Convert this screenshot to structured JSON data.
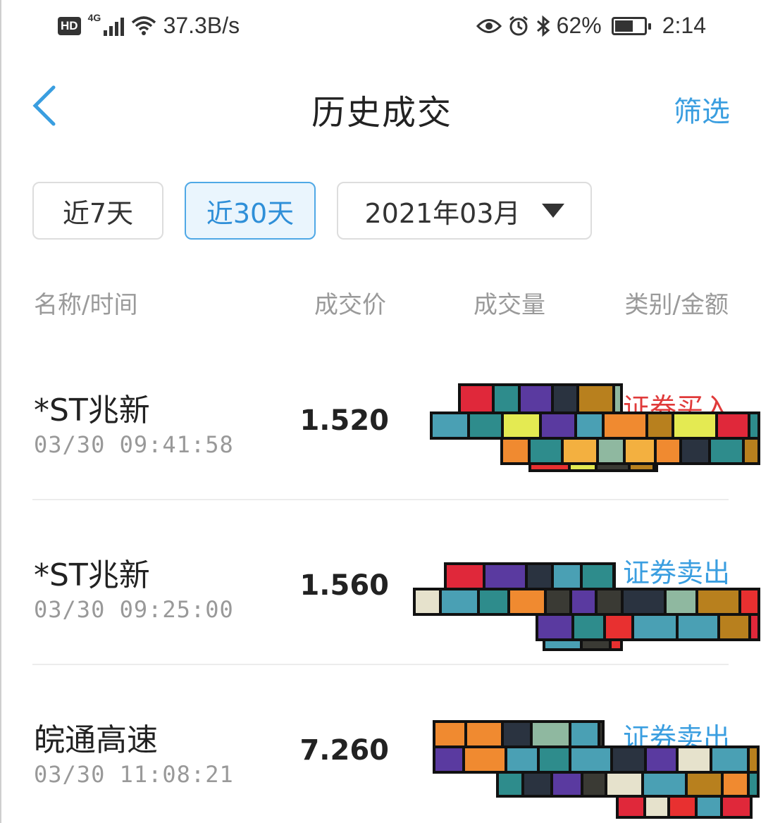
{
  "status_bar": {
    "hd": "HD",
    "network": "4G",
    "speed": "37.3B/s",
    "battery": "62%",
    "battery_level": 0.62,
    "time": "2:14"
  },
  "header": {
    "title": "历史成交",
    "filter_label": "筛选"
  },
  "range": {
    "opt_7": "近7天",
    "opt_30": "近30天",
    "month": "2021年03月",
    "selected": "近30天"
  },
  "columns": {
    "name_time": "名称/时间",
    "price": "成交价",
    "volume": "成交量",
    "type_amount": "类别/金额"
  },
  "trades": [
    {
      "name": "*ST兆新",
      "time": "03/30 09:41:58",
      "price": "1.520",
      "type": "证券买入"
    },
    {
      "name": "*ST兆新",
      "time": "03/30 09:25:00",
      "price": "1.560",
      "type": "证券卖出"
    },
    {
      "name": "皖通高速",
      "time": "03/30 11:08:21",
      "price": "7.260",
      "type": "证券卖出"
    }
  ],
  "colors": {
    "accent": "#3a9ee0",
    "buy": "#e03a3a",
    "sell": "#3a9ee0"
  }
}
